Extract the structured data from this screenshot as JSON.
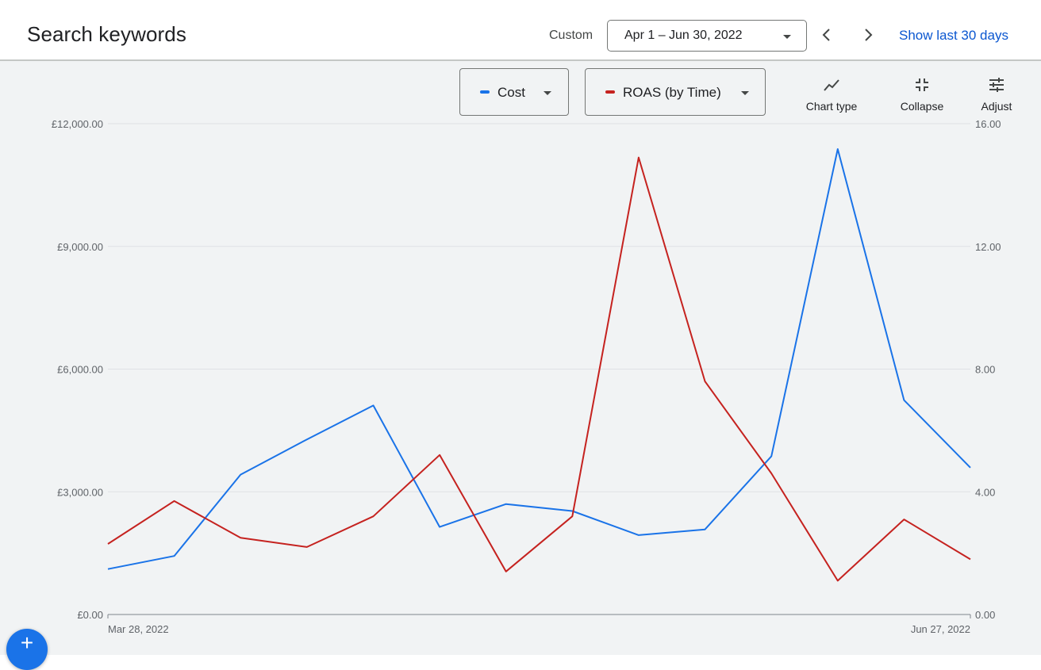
{
  "header": {
    "title": "Search keywords",
    "range_type": "Custom",
    "date_range": "Apr 1 – Jun 30, 2022",
    "prev_icon": "chevron-left-icon",
    "next_icon": "chevron-right-icon",
    "show_last_label": "Show last 30 days"
  },
  "metrics": [
    {
      "label": "Cost",
      "color": "#1a73e8"
    },
    {
      "label": "ROAS (by Time)",
      "color": "#c5221f"
    }
  ],
  "toolbar": {
    "chart_type": {
      "label": "Chart type",
      "icon": "line-chart-icon"
    },
    "collapse": {
      "label": "Collapse",
      "icon": "collapse-icon"
    },
    "adjust": {
      "label": "Adjust",
      "icon": "tune-icon"
    }
  },
  "fab": {
    "icon": "add-icon",
    "glyph": "+"
  },
  "chart_data": {
    "type": "line",
    "x_start_label": "Mar 28, 2022",
    "x_end_label": "Jun 27, 2022",
    "x_count": 14,
    "left_axis": {
      "ticks": [
        "£0.00",
        "£3,000.00",
        "£6,000.00",
        "£9,000.00",
        "£12,000.00"
      ],
      "range": [
        0,
        12000
      ]
    },
    "right_axis": {
      "ticks": [
        "0.00",
        "4.00",
        "8.00",
        "12.00",
        "16.00"
      ],
      "range": [
        0,
        16
      ]
    },
    "grid": true,
    "series": [
      {
        "name": "Cost",
        "axis": "left",
        "color": "#1a73e8",
        "values": [
          1110,
          1430,
          3420,
          4280,
          5110,
          2140,
          2700,
          2530,
          1940,
          2080,
          3870,
          11380,
          5240,
          3590
        ]
      },
      {
        "name": "ROAS (by Time)",
        "axis": "right",
        "color": "#c5221f",
        "values": [
          2.3,
          3.7,
          2.5,
          2.2,
          3.2,
          5.2,
          1.4,
          3.2,
          14.9,
          7.6,
          4.6,
          1.1,
          3.1,
          1.8
        ]
      }
    ]
  }
}
